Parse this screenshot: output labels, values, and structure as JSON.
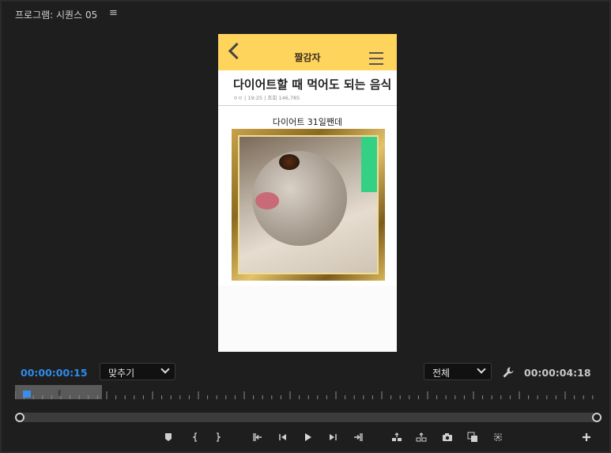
{
  "panel": {
    "title": "프로그램: 시퀀스 05",
    "menu_icon": "hamburger-icon"
  },
  "monitor": {
    "brand": "짤감자",
    "headline": "다이어트할 때 먹어도 되는 음식",
    "meta": "ㅇㅇ | 19:25 | 조회 146,785",
    "caption": "다이어트 31일짼데"
  },
  "timecodes": {
    "current": "00:00:00:15",
    "duration": "00:00:04:18"
  },
  "zoom_dropdown": {
    "selected": "맞추기"
  },
  "resolution_dropdown": {
    "selected": "전체"
  },
  "playhead": {
    "position_fraction": 0.11
  },
  "colors": {
    "accent": "#2d8ceb",
    "header_yellow": "#ffd45c",
    "background": "#1e1e1e"
  },
  "controls": [
    {
      "name": "add-marker-button",
      "icon": "marker-icon"
    },
    {
      "name": "mark-in-button",
      "icon": "brace-left-icon"
    },
    {
      "name": "mark-out-button",
      "icon": "brace-right-icon"
    },
    {
      "name": "go-to-in-button",
      "icon": "go-to-in-icon"
    },
    {
      "name": "step-back-button",
      "icon": "step-back-icon"
    },
    {
      "name": "play-button",
      "icon": "play-icon"
    },
    {
      "name": "step-forward-button",
      "icon": "step-forward-icon"
    },
    {
      "name": "go-to-out-button",
      "icon": "go-to-out-icon"
    },
    {
      "name": "lift-button",
      "icon": "lift-icon"
    },
    {
      "name": "extract-button",
      "icon": "extract-icon"
    },
    {
      "name": "export-frame-button",
      "icon": "camera-icon"
    },
    {
      "name": "comparison-view-button",
      "icon": "comparison-icon"
    },
    {
      "name": "proxy-toggle-button",
      "icon": "proxy-icon"
    },
    {
      "name": "button-editor",
      "icon": "plus-icon"
    }
  ]
}
